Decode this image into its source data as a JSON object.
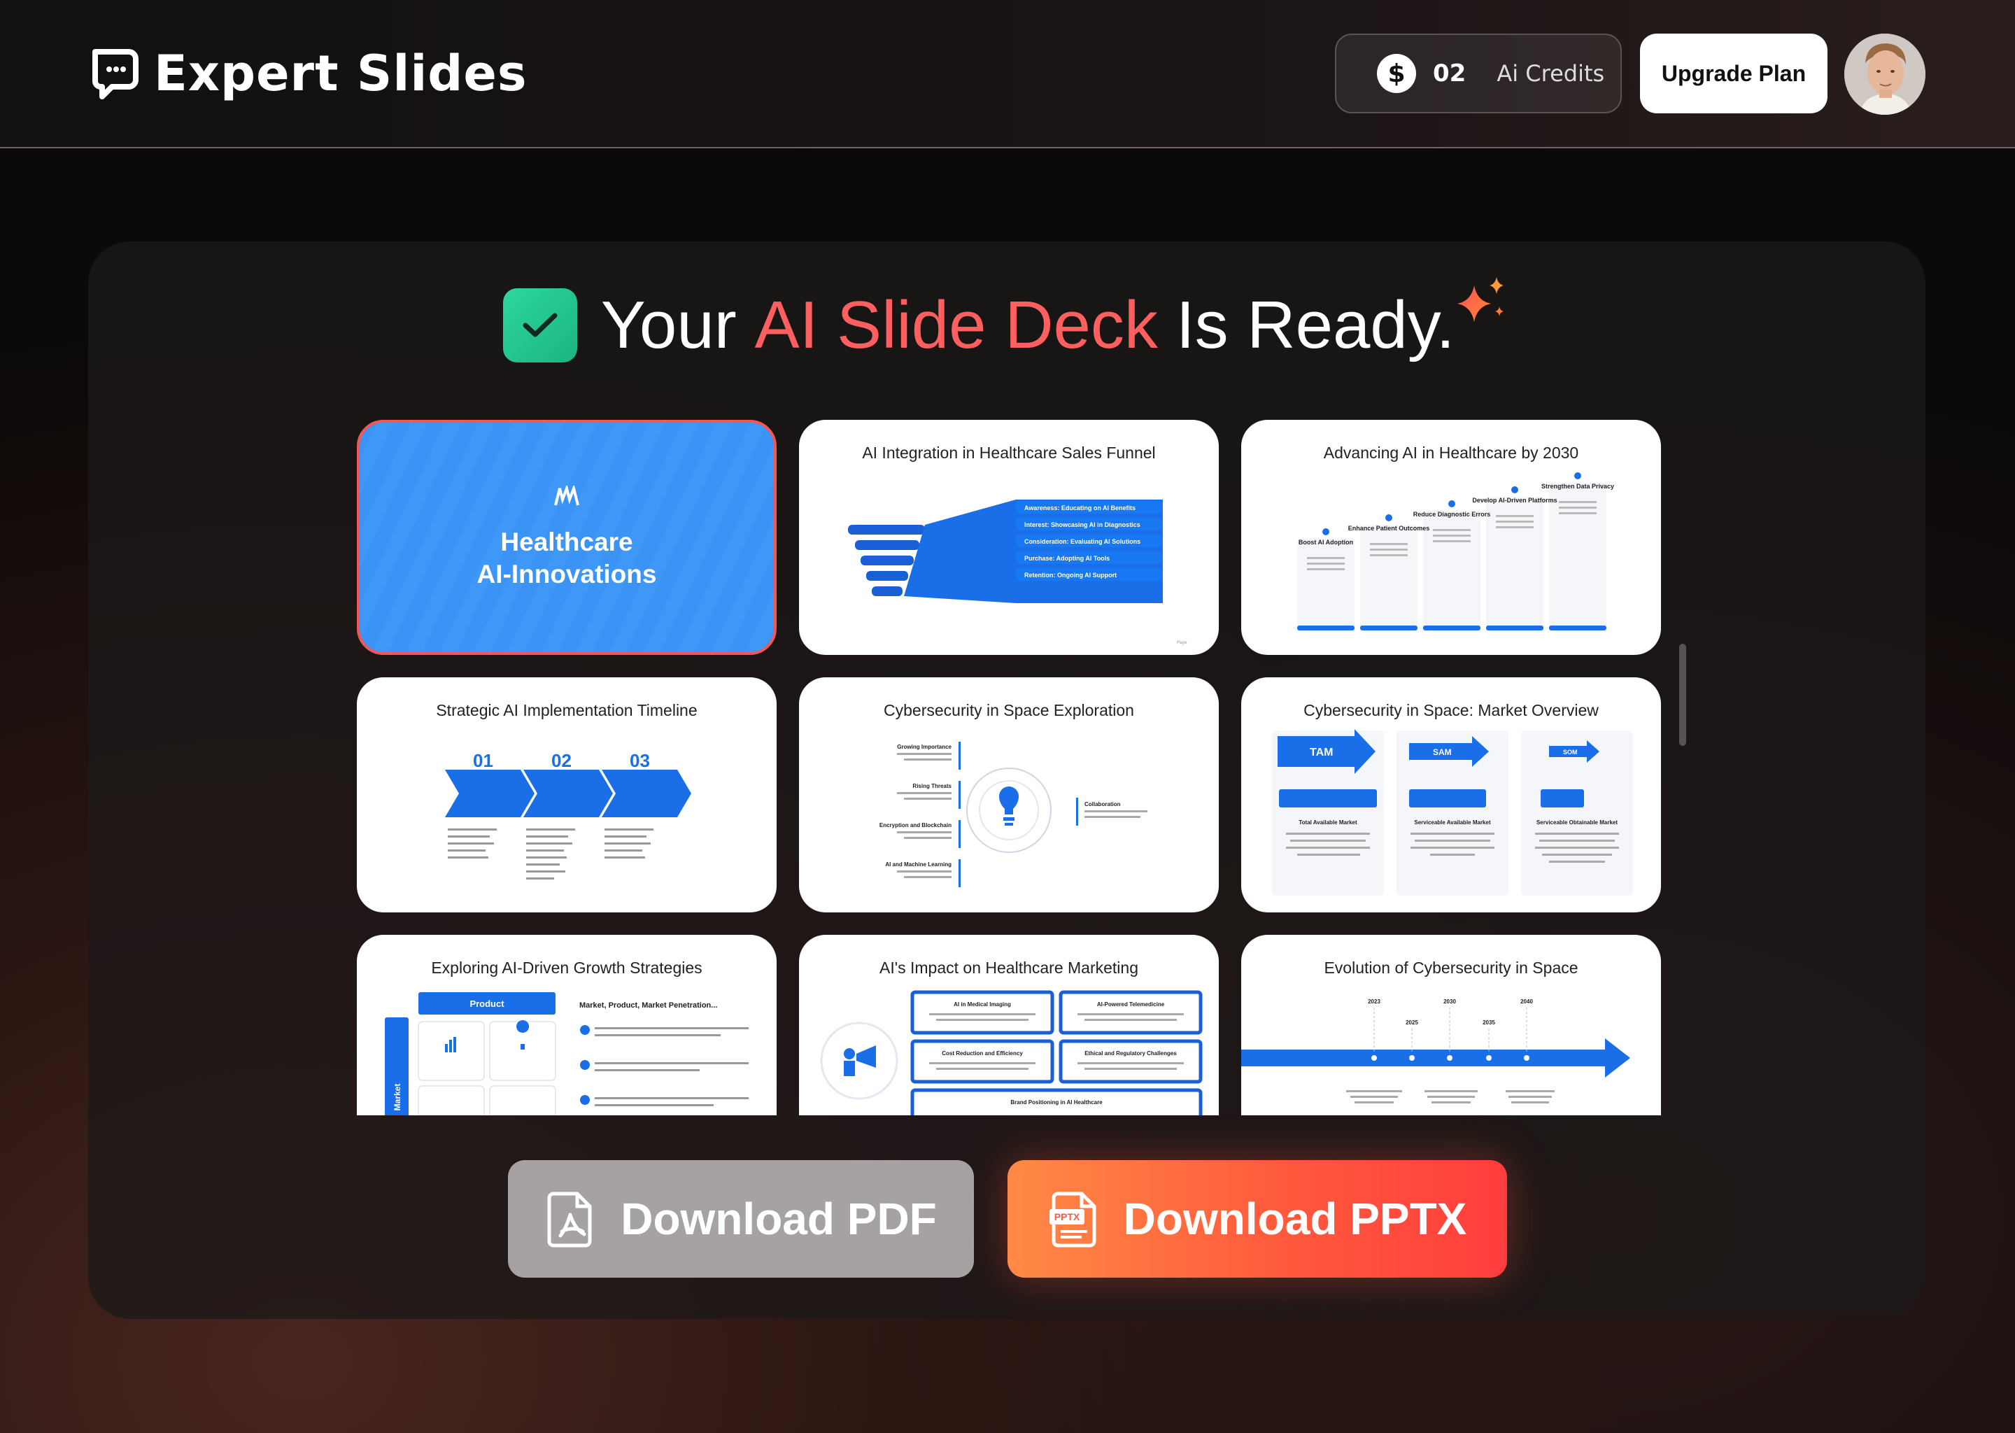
{
  "header": {
    "brand": "Expert Slides",
    "credits_count": "02",
    "credits_label": "Ai Credits",
    "coin_symbol": "$",
    "upgrade_label": "Upgrade Plan"
  },
  "headline": {
    "part1": "Your",
    "accent": "AI Slide Deck",
    "part2": "Is Ready.",
    "accent_color": "#ff5f5f"
  },
  "slides": [
    {
      "title": "Healthcare AI-Innovations",
      "line1": "Healthcare",
      "line2": "AI-Innovations",
      "selected": true
    },
    {
      "title": "AI Integration in Healthcare Sales Funnel",
      "stages": [
        "Awareness: Educating on AI Benefits",
        "Interest: Showcasing AI in Diagnostics",
        "Consideration: Evaluating AI Solutions",
        "Purchase: Adopting AI Tools",
        "Retention: Ongoing AI Support"
      ]
    },
    {
      "title": "Advancing AI in Healthcare by 2030",
      "steps": [
        "Boost AI Adoption",
        "Enhance Patient Outcomes",
        "Reduce Diagnostic Errors",
        "Develop AI-Driven Platforms",
        "Strengthen Data Privacy"
      ]
    },
    {
      "title": "Strategic AI Implementation Timeline",
      "numbers": [
        "01",
        "02",
        "03"
      ]
    },
    {
      "title": "Cybersecurity in Space Exploration",
      "items": [
        "Growing Importance",
        "Rising Threats",
        "Encryption and Blockchain",
        "AI and Machine Learning",
        "Collaboration"
      ]
    },
    {
      "title": "Cybersecurity in Space: Market Overview",
      "tags": [
        "TAM",
        "SAM",
        "SOM"
      ],
      "labels": [
        "Total Available Market",
        "Serviceable Available Market",
        "Serviceable Obtainable Market"
      ]
    },
    {
      "title": "Exploring AI-Driven Growth Strategies",
      "box": "Product",
      "side": "Market",
      "heading": "Market, Product, Market Penetration..."
    },
    {
      "title": "AI's Impact on Healthcare Marketing",
      "boxes": [
        "AI in Medical Imaging",
        "AI-Powered Telemedicine",
        "Cost Reduction and Efficiency",
        "Ethical and Regulatory Challenges",
        "Brand Positioning in AI Healthcare"
      ]
    },
    {
      "title": "Evolution of Cybersecurity in Space",
      "years": [
        "2023",
        "2025",
        "2030",
        "2035",
        "2040"
      ]
    }
  ],
  "actions": {
    "pdf_label": "Download PDF",
    "pptx_label": "Download PPTX"
  }
}
